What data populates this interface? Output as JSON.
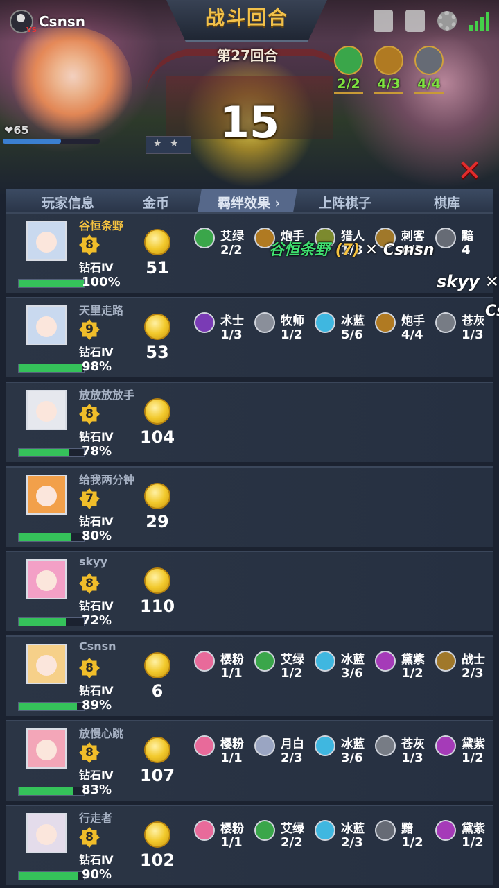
{
  "top": {
    "user_name": "Csnsn",
    "hp": "65",
    "banner": "战斗回合",
    "round": "第27回合",
    "countdown": "15",
    "bonds": [
      {
        "icon": "leaf-icon",
        "count": "2/2",
        "color": "#3aa64a"
      },
      {
        "icon": "cannon-icon",
        "count": "4/3",
        "color": "#b07a22"
      },
      {
        "icon": "eye-icon",
        "count": "4/4",
        "color": "#666b75"
      }
    ]
  },
  "header": {
    "player_info": "玩家信息",
    "gold": "金币",
    "synergy": "羁绊效果",
    "on_board": "上阵棋子",
    "bench": "棋库"
  },
  "floating": {
    "line1_name": "谷恒条野",
    "line1_num": "(7)",
    "line1_target": "Csnsn",
    "line2": "skyy",
    "line3": "Cs"
  },
  "players": [
    {
      "name": "谷恒条野",
      "level": "8",
      "rank": "钻石Ⅳ",
      "hp_pct": "100%",
      "hp": 1.0,
      "gold": "51",
      "me": true,
      "avatar": "#c9d9ef",
      "synergies": [
        {
          "icon": "leaf-icon",
          "name": "艾绿",
          "count": "2/2",
          "color": "#3aa64a"
        },
        {
          "icon": "cannon-icon",
          "name": "炮手",
          "count": "",
          "color": "#b07a22"
        },
        {
          "icon": "hunter-icon",
          "name": "猎人",
          "count": "1/3",
          "color": "#7c8a2e"
        },
        {
          "icon": "dagger-icon",
          "name": "刺客",
          "count": "4/3",
          "color": "#a0782a"
        },
        {
          "icon": "eye-icon",
          "name": "黯",
          "count": "4",
          "color": "#666b75"
        }
      ]
    },
    {
      "name": "天里走路",
      "level": "9",
      "rank": "钻石Ⅳ",
      "hp_pct": "98%",
      "hp": 0.98,
      "gold": "53",
      "me": false,
      "avatar": "#c9d9ef",
      "synergies": [
        {
          "icon": "mage-icon",
          "name": "术士",
          "count": "1/3",
          "color": "#7a3bb5"
        },
        {
          "icon": "cross-icon",
          "name": "牧师",
          "count": "1/2",
          "color": "#8a8f9a"
        },
        {
          "icon": "snowflake-icon",
          "name": "冰蓝",
          "count": "5/6",
          "color": "#3fb7e0"
        },
        {
          "icon": "cannon-icon",
          "name": "炮手",
          "count": "4/4",
          "color": "#b07a22"
        },
        {
          "icon": "fan-icon",
          "name": "苍灰",
          "count": "1/3",
          "color": "#777c85"
        }
      ]
    },
    {
      "name": "放放放放手",
      "level": "8",
      "rank": "钻石Ⅳ",
      "hp_pct": "78%",
      "hp": 0.78,
      "gold": "104",
      "me": false,
      "avatar": "#e6e8ee",
      "synergies": []
    },
    {
      "name": "给我两分钟",
      "level": "7",
      "rank": "钻石Ⅳ",
      "hp_pct": "80%",
      "hp": 0.8,
      "gold": "29",
      "me": false,
      "avatar": "#f2a04a",
      "synergies": []
    },
    {
      "name": "skyy",
      "level": "8",
      "rank": "钻石Ⅳ",
      "hp_pct": "72%",
      "hp": 0.72,
      "gold": "110",
      "me": false,
      "avatar": "#f3a0c6",
      "synergies": []
    },
    {
      "name": "Csnsn",
      "level": "8",
      "rank": "钻石Ⅳ",
      "hp_pct": "89%",
      "hp": 0.89,
      "gold": "6",
      "me": false,
      "avatar": "#f6d089",
      "synergies": [
        {
          "icon": "sakura-icon",
          "name": "樱粉",
          "count": "1/1",
          "color": "#e86a9a"
        },
        {
          "icon": "leaf-icon",
          "name": "艾绿",
          "count": "1/2",
          "color": "#3aa64a"
        },
        {
          "icon": "snowflake-icon",
          "name": "冰蓝",
          "count": "3/6",
          "color": "#3fb7e0"
        },
        {
          "icon": "spiral-icon",
          "name": "黛紫",
          "count": "1/2",
          "color": "#a53bb8"
        },
        {
          "icon": "warrior-icon",
          "name": "战士",
          "count": "2/3",
          "color": "#a0782a"
        }
      ]
    },
    {
      "name": "放慢心跳",
      "level": "8",
      "rank": "钻石Ⅳ",
      "hp_pct": "83%",
      "hp": 0.83,
      "gold": "107",
      "me": false,
      "avatar": "#f3a6b8",
      "synergies": [
        {
          "icon": "sakura-icon",
          "name": "樱粉",
          "count": "1/1",
          "color": "#e86a9a"
        },
        {
          "icon": "moon-icon",
          "name": "月白",
          "count": "2/3",
          "color": "#9aa5c2"
        },
        {
          "icon": "snowflake-icon",
          "name": "冰蓝",
          "count": "3/6",
          "color": "#3fb7e0"
        },
        {
          "icon": "fan-icon",
          "name": "苍灰",
          "count": "1/3",
          "color": "#777c85"
        },
        {
          "icon": "spiral-icon",
          "name": "黛紫",
          "count": "1/2",
          "color": "#a53bb8"
        }
      ]
    },
    {
      "name": "行走者",
      "level": "8",
      "rank": "钻石Ⅳ",
      "hp_pct": "90%",
      "hp": 0.9,
      "gold": "102",
      "me": false,
      "avatar": "#e4dceb",
      "synergies": [
        {
          "icon": "sakura-icon",
          "name": "樱粉",
          "count": "1/1",
          "color": "#e86a9a"
        },
        {
          "icon": "leaf-icon",
          "name": "艾绿",
          "count": "2/2",
          "color": "#3aa64a"
        },
        {
          "icon": "snowflake-icon",
          "name": "冰蓝",
          "count": "2/3",
          "color": "#3fb7e0"
        },
        {
          "icon": "eye-icon",
          "name": "黯",
          "count": "1/2",
          "color": "#666b75"
        },
        {
          "icon": "spiral-icon",
          "name": "黛紫",
          "count": "1/2",
          "color": "#a53bb8"
        }
      ]
    }
  ]
}
